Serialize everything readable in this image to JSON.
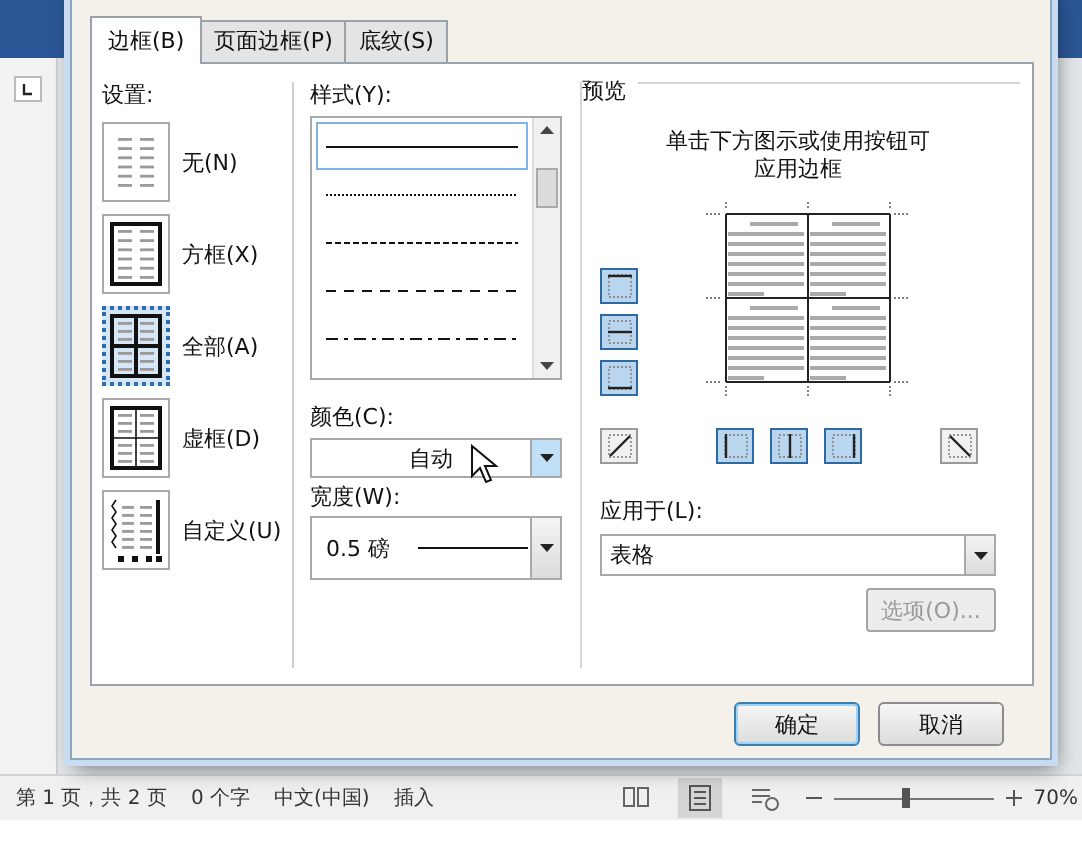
{
  "dialog": {
    "tabs": [
      {
        "label": "边框(B)",
        "selected": true
      },
      {
        "label": "页面边框(P)",
        "selected": false
      },
      {
        "label": "底纹(S)",
        "selected": false
      }
    ],
    "settings": {
      "label": "设置:",
      "items": [
        {
          "label": "无(N)",
          "kind": "none",
          "selected": false
        },
        {
          "label": "方框(X)",
          "kind": "box",
          "selected": false
        },
        {
          "label": "全部(A)",
          "kind": "all",
          "selected": true
        },
        {
          "label": "虚框(D)",
          "kind": "grid",
          "selected": false
        },
        {
          "label": "自定义(U)",
          "kind": "custom",
          "selected": false
        }
      ]
    },
    "style": {
      "label": "样式(Y):",
      "items": [
        {
          "kind": "solid",
          "selected": true
        },
        {
          "kind": "dotted",
          "selected": false
        },
        {
          "kind": "dashed-fine",
          "selected": false
        },
        {
          "kind": "dashed",
          "selected": false
        },
        {
          "kind": "dash-dot",
          "selected": false
        }
      ]
    },
    "color": {
      "label": "颜色(C):",
      "value": "自动"
    },
    "width": {
      "label": "宽度(W):",
      "value": "0.5 磅"
    },
    "preview": {
      "title": "预览",
      "hint": "单击下方图示或使用按钮可应用边框",
      "side_buttons": [
        {
          "kind": "top",
          "on": true
        },
        {
          "kind": "middle",
          "on": true
        },
        {
          "kind": "bottom",
          "on": true
        }
      ],
      "bottom_buttons": [
        {
          "kind": "diag-up",
          "on": false
        },
        {
          "kind": "left",
          "on": true
        },
        {
          "kind": "center",
          "on": true
        },
        {
          "kind": "right",
          "on": true
        },
        {
          "kind": "diag-down",
          "on": false
        }
      ]
    },
    "apply_to": {
      "label": "应用于(L):",
      "value": "表格"
    },
    "options_button": {
      "label": "选项(O)...",
      "disabled": true
    },
    "buttons": [
      {
        "label": "确定",
        "default": true
      },
      {
        "label": "取消",
        "default": false
      }
    ]
  },
  "status_bar": {
    "items": [
      "第 1 页，共 2 页",
      "0 个字",
      "中文(中国)",
      "插入"
    ],
    "zoom_slider": {
      "level": 0.45
    },
    "zoom": "70%"
  }
}
